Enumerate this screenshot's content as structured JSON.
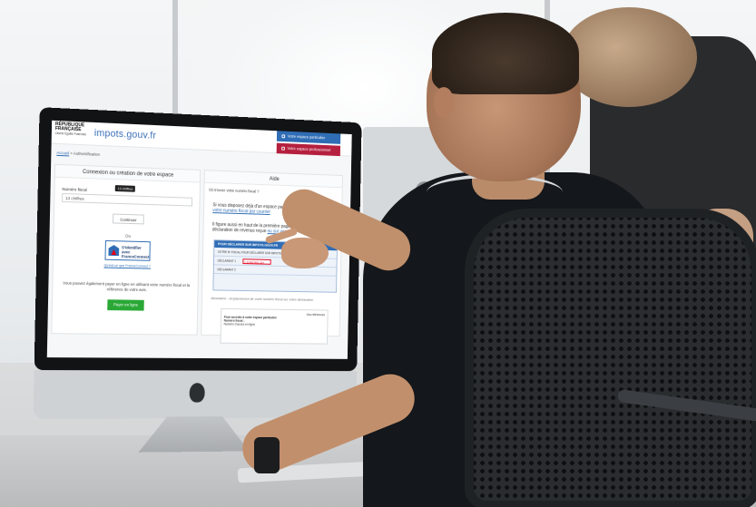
{
  "site": {
    "marianne_line1": "RÉPUBLIQUE",
    "marianne_line2": "FRANÇAISE",
    "motto": "Liberté Égalité Fraternité",
    "logo": "impots.gouv.fr",
    "btn_particulier": "Votre espace particulier",
    "btn_professionnel": "Votre espace professionnel"
  },
  "breadcrumb": {
    "home": "Accueil",
    "separator": " > ",
    "current": "Authentification"
  },
  "login_panel": {
    "title": "Connexion ou création de votre espace",
    "field_label": "Numéro fiscal",
    "tooltip": "13 chiffres",
    "placeholder": "13 chiffres",
    "continue_label": "Continuer",
    "or_label": "Ou",
    "fc_line1": "S'identifier avec",
    "fc_line2": "FranceConnect",
    "fc_link": "Qu'est-ce que FranceConnect ?",
    "pay_text": "Vous pouvez également payer en ligne en utilisant votre numéro fiscal et la référence de votre avis.",
    "pay_button": "Payer en ligne"
  },
  "help_panel": {
    "title": "Aide",
    "question": "Où trouver votre numéro fiscal ?",
    "para1_start": "Si vous disposez déjà d'un espace particulier, vous pouvez ",
    "para1_link": "recevoir votre numéro fiscal par courriel",
    "para2_start": "Il figure aussi en haut de la première page de votre dernière déclaration de revenus reçue ",
    "para2_link": "ou sur vos avis",
    "form_head": "POUR DÉCLARER SUR IMPOTS.GOUV.FR",
    "form_row1": "VOTRE Nº FISCAL POUR DÉCLARER SUR IMPOTS.GOUV.FR",
    "form_row2": "DÉCLARANT 1",
    "form_highlight": "1 234567891 234",
    "form_row3": "DÉCLARANT 2",
    "illustration": "Illustration : emplacement de votre numéro fiscal sur votre déclaration",
    "sample_title": "Vos références",
    "sample_line1": "Pour accéder à votre espace particulier",
    "sample_line2": "Numéro fiscal :",
    "sample_line3": "Numéro d'accès en ligne"
  },
  "colors": {
    "brand_blue": "#2f6db5",
    "pro_red": "#b5203e",
    "pay_green": "#2aa836"
  }
}
